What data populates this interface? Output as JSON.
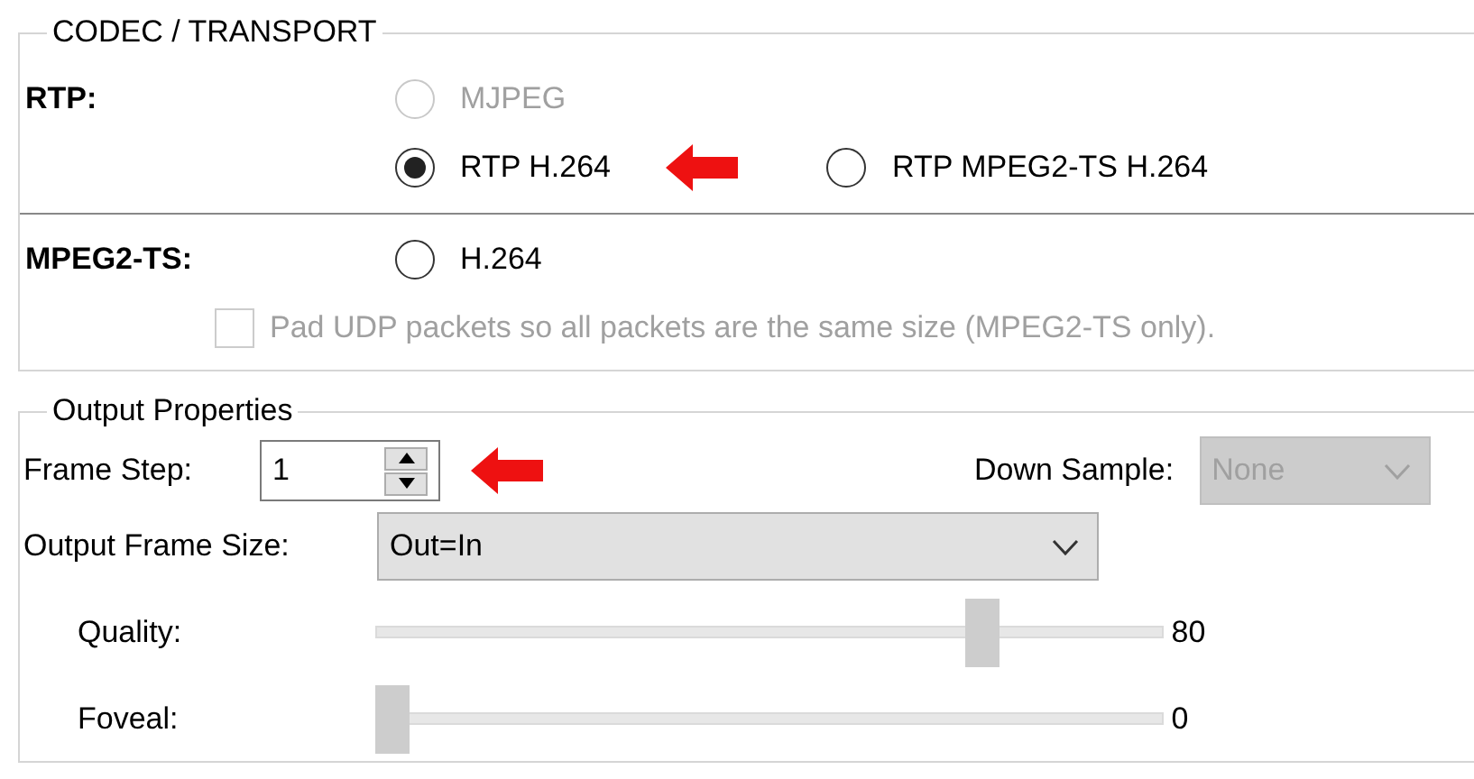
{
  "codec_group": {
    "title": "CODEC / TRANSPORT",
    "rtp": {
      "label": "RTP:",
      "options": [
        {
          "label": "MJPEG",
          "selected": false,
          "disabled": true
        },
        {
          "label": "RTP H.264",
          "selected": true,
          "disabled": false
        },
        {
          "label": "RTP MPEG2-TS H.264",
          "selected": false,
          "disabled": false
        }
      ]
    },
    "mpeg2ts": {
      "label": "MPEG2-TS:",
      "options": [
        {
          "label": "H.264",
          "selected": false,
          "disabled": false
        }
      ]
    },
    "pad_checkbox": {
      "label": "Pad UDP packets so all packets are the same size (MPEG2-TS only).",
      "checked": false,
      "disabled": true
    }
  },
  "output_group": {
    "title": "Output Properties",
    "frame_step": {
      "label": "Frame Step:",
      "value": "1"
    },
    "down_sample": {
      "label": "Down Sample:",
      "value": "None",
      "disabled": true
    },
    "output_frame_size": {
      "label": "Output Frame Size:",
      "value": "Out=In"
    },
    "sliders": [
      {
        "label": "Quality:",
        "level": 0.8,
        "reading": "80"
      },
      {
        "label": "Foveal:",
        "level": 0,
        "reading": "0"
      }
    ]
  }
}
